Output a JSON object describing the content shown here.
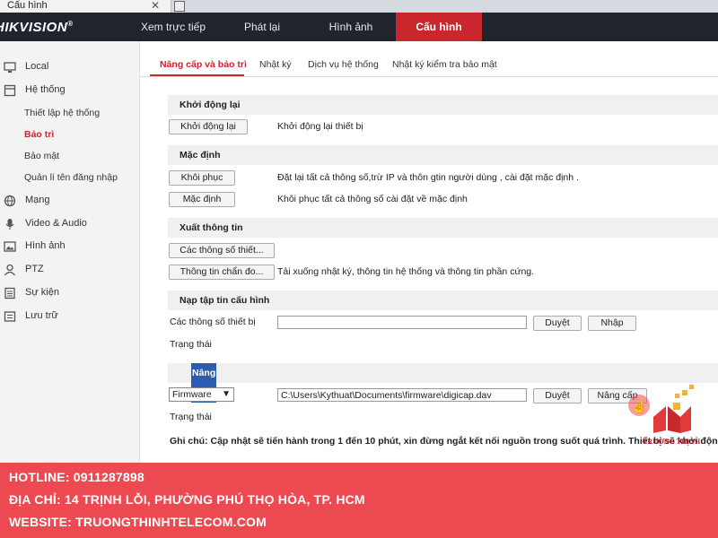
{
  "browser": {
    "tab_title": "Cấu hình",
    "close_glyph": "✕"
  },
  "brand": {
    "logo": "HIKVISION",
    "registered": "®"
  },
  "nav": {
    "items": [
      "Xem trực tiếp",
      "Phát lại",
      "Hình ảnh",
      "Cấu hình"
    ],
    "active": "Cấu hình",
    "active_color": "#c8272d"
  },
  "sidebar": {
    "items": [
      {
        "label": "Local",
        "icon": "monitor-icon"
      },
      {
        "label": "Hệ thống",
        "icon": "system-icon"
      },
      {
        "label": "Mạng",
        "icon": "globe-icon"
      },
      {
        "label": "Video & Audio",
        "icon": "microphone-icon"
      },
      {
        "label": "Hình ảnh",
        "icon": "image-icon"
      },
      {
        "label": "PTZ",
        "icon": "person-icon"
      },
      {
        "label": "Sự kiện",
        "icon": "event-list-icon"
      },
      {
        "label": "Lưu trữ",
        "icon": "storage-icon"
      }
    ],
    "system_sub": [
      "Thiết lập hệ thống",
      "Bảo trì",
      "Bảo mật",
      "Quản lí tên đăng nhập"
    ],
    "active_sub": "Bảo trì"
  },
  "tabs": [
    "Nâng cấp và bảo trì",
    "Nhật ký",
    "Dịch vụ hệ thống",
    "Nhật ký kiểm tra bảo mật"
  ],
  "sections": {
    "reboot": {
      "title": "Khởi động lại",
      "button": "Khởi động lại",
      "desc": "Khởi động lại thiết bị"
    },
    "default": {
      "title": "Mặc định",
      "restore_button": "Khôi phục",
      "restore_desc": "Đặt lại tất cả thông số,trừ IP và thôn gtin người dùng , cài đặt mặc định .",
      "default_button": "Mặc định",
      "default_desc": "Khôi phục tất cả thông số cài đặt về mặc định"
    },
    "export": {
      "title": "Xuất thông tin",
      "params_button": "Các thông số thiết...",
      "diag_button": "Thông tin chẩn đo...",
      "diag_desc": "Tải xuống nhật ký, thông tin hệ thống và thông tin phần cứng."
    },
    "import": {
      "title": "Nạp tập tin cấu hình",
      "label": "Các thông số thiết bị",
      "file_value": "",
      "browse": "Duyệt",
      "import_button": "Nhập",
      "status_label": "Trạng thái"
    },
    "upgrade": {
      "title": "Nâng cấp",
      "select_value": "Firmware",
      "file_value": "C:\\Users\\Kythuat\\Documents\\firmware\\digicap.dav",
      "browse": "Duyệt",
      "upgrade_button": "Nâng cấp",
      "status_label": "Trạng thái"
    },
    "note": "Ghi chú: Cập nhật sẽ tiến hành trong 1 đến 10 phút, xin đừng ngắt kết nối nguồn trong suốt quá trình. Thiết bị sẽ khởi động lại sau k"
  },
  "banner": {
    "hotline": "HOTLINE: 0911287898",
    "address": "ĐỊA CHỈ: 14 TRỊNH LỖI, PHƯỜNG PHÚ THỌ HÒA, TP. HCM",
    "website": "WEBSITE: TRUONGTHINHTELECOM.COM",
    "color": "#ec4a50"
  },
  "watermark": {
    "text": "TRƯỜNG THỊNH"
  }
}
